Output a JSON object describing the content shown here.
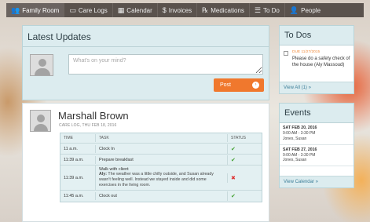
{
  "nav": {
    "items": [
      {
        "label": "Family Room",
        "icon": "family-icon",
        "glyph": "👥"
      },
      {
        "label": "Care Logs",
        "icon": "care-logs-icon",
        "glyph": "▭"
      },
      {
        "label": "Calendar",
        "icon": "calendar-icon",
        "glyph": "▦"
      },
      {
        "label": "Invoices",
        "icon": "dollar-icon",
        "glyph": "$"
      },
      {
        "label": "Medications",
        "icon": "rx-icon",
        "glyph": "℞"
      },
      {
        "label": "To Do",
        "icon": "list-icon",
        "glyph": "☰"
      },
      {
        "label": "People",
        "icon": "person-icon",
        "glyph": "👤"
      }
    ]
  },
  "updates": {
    "title": "Latest Updates",
    "status_placeholder": "What's on your mind?",
    "post_label": "Post",
    "post_arrow": "›"
  },
  "entry": {
    "name": "Marshall Brown",
    "meta": "CARE LOG, THU FEB 18, 2016",
    "columns": {
      "time": "TIME",
      "task": "TASK",
      "status": "STATUS"
    },
    "rows": [
      {
        "time": "11 a.m.",
        "task": "Clock In",
        "note_author": "",
        "note": "",
        "status": "done"
      },
      {
        "time": "11:39 a.m.",
        "task": "Prepare breakfast",
        "note_author": "",
        "note": "",
        "status": "done"
      },
      {
        "time": "11:39 a.m.",
        "task": "Walk with client",
        "note_author": "Aly:",
        "note": " The weather was a little chilly outside, and Susan already wasn't feeling well. Instead we stayed inside and did some exercises in the living room.",
        "status": "not-done"
      },
      {
        "time": "11:45 a.m.",
        "task": "Clock out",
        "note_author": "",
        "note": "",
        "status": "done"
      }
    ],
    "check_glyph": "✔",
    "cross_glyph": "✖"
  },
  "todos": {
    "title": "To Dos",
    "item": {
      "due": "DUE 11/27/2015",
      "text": "Please do a safety check of the house (Aly Massoud)"
    },
    "view_all": "View All (1) »"
  },
  "events": {
    "title": "Events",
    "items": [
      {
        "date": "SAT FEB 20, 2016",
        "time": "9:00 AM - 3:30 PM",
        "who": "Jones, Susan"
      },
      {
        "date": "SAT FEB 27, 2016",
        "time": "9:00 AM - 3:30 PM",
        "who": "Jones, Susan"
      }
    ],
    "view_calendar": "View Calendar »"
  },
  "colors": {
    "nav_bg": "#5a524d",
    "panel_bg": "#dcecef",
    "accent_orange": "#f0782d",
    "link_blue": "#3c7e99",
    "check_green": "#44a133",
    "cross_red": "#dd3333",
    "due_orange": "#f08a3a"
  }
}
